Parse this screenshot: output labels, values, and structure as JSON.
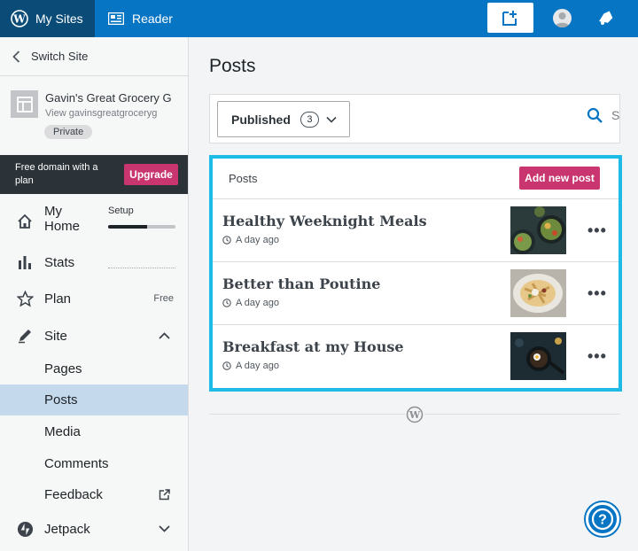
{
  "topbar": {
    "my_sites_label": "My Sites",
    "reader_label": "Reader",
    "colors": {
      "bar": "#0675c4",
      "my_sites_bg": "#0a4b78"
    }
  },
  "sidebar": {
    "switch_site": "Switch Site",
    "site": {
      "name": "Gavin's Great Grocery G",
      "url": "View gavinsgreatgroceryg",
      "visibility": "Private"
    },
    "promo": {
      "text": "Free domain with a plan",
      "button": "Upgrade"
    },
    "items": {
      "home": {
        "label": "My Home",
        "setup_label": "Setup",
        "setup_progress": 0.58
      },
      "stats": {
        "label": "Stats"
      },
      "plan": {
        "label": "Plan",
        "badge": "Free"
      },
      "site": {
        "label": "Site"
      },
      "pages": {
        "label": "Pages"
      },
      "posts": {
        "label": "Posts"
      },
      "media": {
        "label": "Media"
      },
      "comments": {
        "label": "Comments"
      },
      "feedback": {
        "label": "Feedback"
      },
      "jetpack": {
        "label": "Jetpack"
      }
    },
    "active_item": "Posts"
  },
  "main": {
    "title": "Posts",
    "filter": {
      "status_label": "Published",
      "status_count": "3",
      "search_stub": "S"
    },
    "panel": {
      "label": "Posts",
      "add_button": "Add new post"
    },
    "posts": [
      {
        "title": "Healthy Weeknight Meals",
        "time": "A day ago",
        "thumb": "salad-bowls-image",
        "more": "•••"
      },
      {
        "title": "Better than Poutine",
        "time": "A day ago",
        "thumb": "fries-platter-image",
        "more": "•••"
      },
      {
        "title": "Breakfast at my House",
        "time": "A day ago",
        "thumb": "breakfast-skillet-image",
        "more": "•••"
      }
    ],
    "highlight_color": "#1ebbe6",
    "accent_pink": "#c9356e"
  },
  "help_button_label": "?"
}
